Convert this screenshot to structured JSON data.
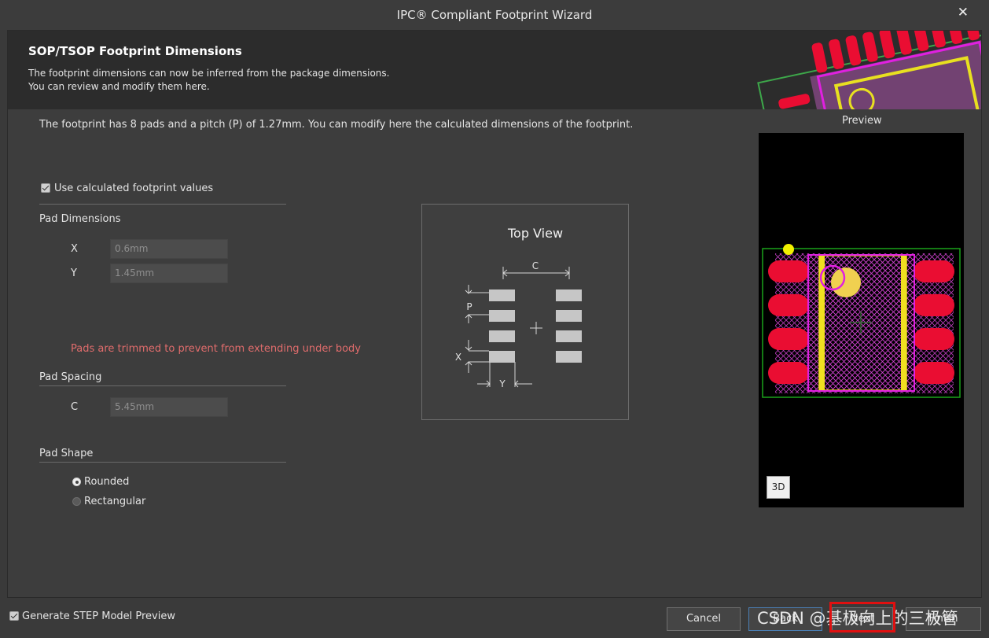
{
  "window": {
    "title": "IPC® Compliant Footprint Wizard",
    "close_glyph": "✕"
  },
  "header": {
    "title": "SOP/TSOP Footprint Dimensions",
    "desc_line1": "The footprint dimensions can now be inferred from the package dimensions.",
    "desc_line2": "You can review and modify them here."
  },
  "intro": "The footprint has 8 pads and a pitch (P) of 1.27mm. You can modify here the calculated dimensions of the footprint.",
  "use_calculated": {
    "label": "Use calculated footprint values",
    "checked": true
  },
  "pad_dimensions": {
    "heading": "Pad Dimensions",
    "x_label": "X",
    "x_value": "0.6mm",
    "y_label": "Y",
    "y_value": "1.45mm"
  },
  "warning": {
    "text": "Pads are trimmed to prevent from extending under body",
    "color": "#e06c6c"
  },
  "pad_spacing": {
    "heading": "Pad Spacing",
    "c_label": "C",
    "c_value": "5.45mm"
  },
  "pad_shape": {
    "heading": "Pad Shape",
    "options": [
      {
        "label": "Rounded",
        "selected": true
      },
      {
        "label": "Rectangular",
        "selected": false
      }
    ]
  },
  "top_view": {
    "title": "Top View",
    "label_c": "C",
    "label_p": "P",
    "label_x": "X",
    "label_y": "Y"
  },
  "preview": {
    "label": "Preview",
    "btn_3d": "3D"
  },
  "footer": {
    "step_preview": {
      "label": "Generate STEP Model Preview",
      "checked": true
    },
    "buttons": {
      "cancel": "Cancel",
      "back": "Back",
      "next": "Next",
      "finish": "Finish"
    },
    "watermark": "CSDN @基极向上的三极管"
  },
  "colors": {
    "pad_red": "#ea0d32",
    "courtyard_green": "#1aa31a",
    "silk_magenta": "#e020e0",
    "body_yellow": "#f0e020",
    "highlight_red": "#e01010"
  }
}
